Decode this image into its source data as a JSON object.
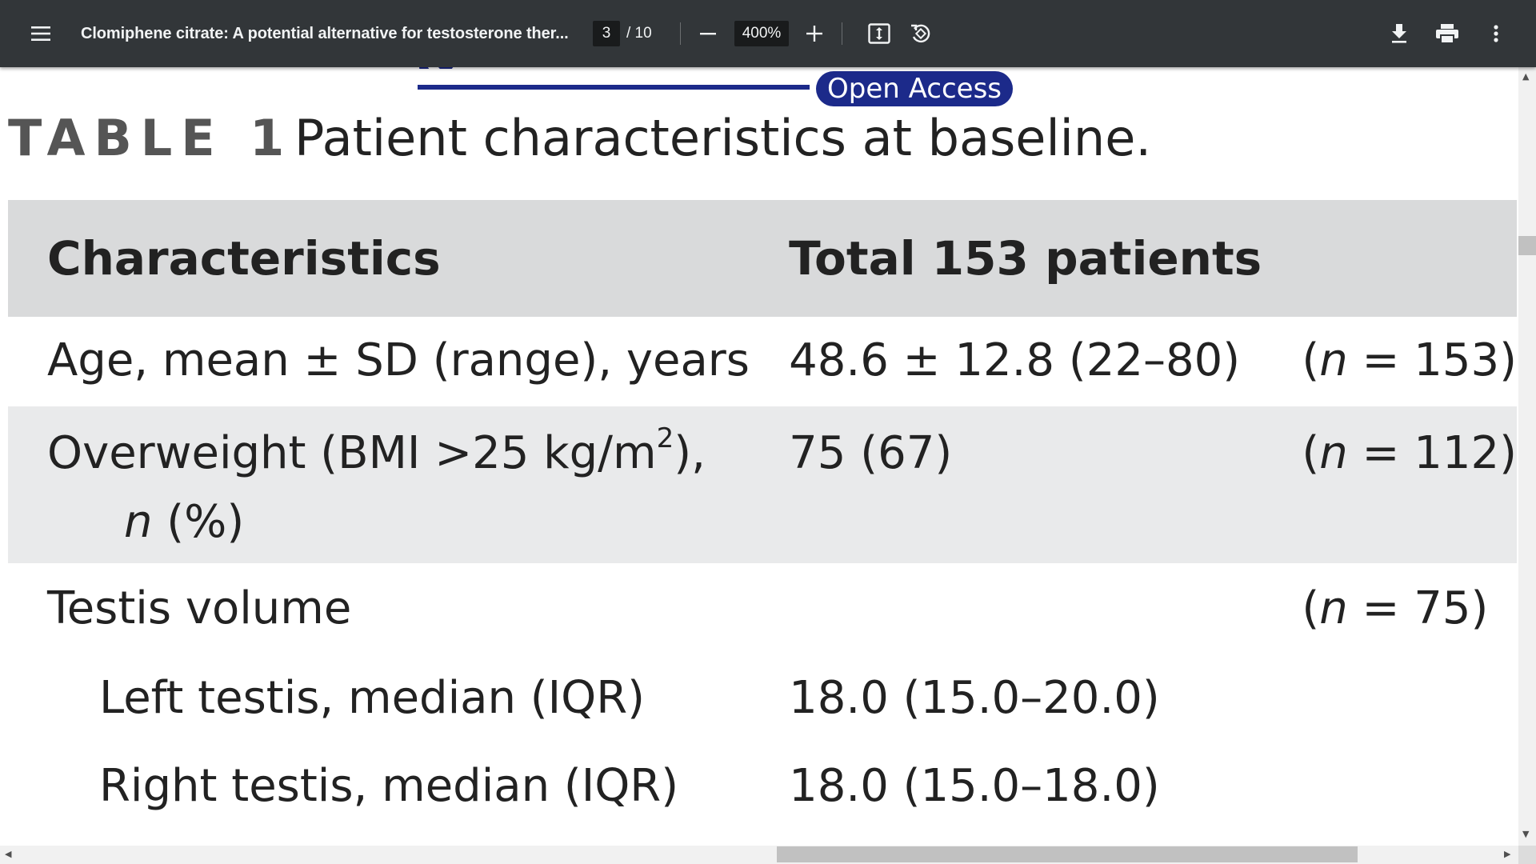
{
  "toolbar": {
    "menu_icon": "hamburger-menu-icon",
    "title": "Clomiphene citrate: A potential alternative for testosterone ther...",
    "current_page": "3",
    "page_total": "/ 10",
    "zoom": "400%",
    "zoom_out_icon": "minus-icon",
    "zoom_in_icon": "plus-icon",
    "fit_icon": "fit-to-page-icon",
    "rotate_icon": "rotate-counterclockwise-icon",
    "download_icon": "download-icon",
    "print_icon": "print-icon",
    "more_icon": "more-vertical-icon"
  },
  "document": {
    "open_access_badge": "Open Access",
    "table_label": "TABLE 1",
    "table_caption": "Patient characteristics at baseline.",
    "header": {
      "col1": "Characteristics",
      "col2": "Total 153 patients"
    },
    "rows": [
      {
        "label": "Age, mean ± SD (range), years",
        "value": "48.6 ± 12.8 (22–80)",
        "n_open": "(",
        "n_var": "n",
        "n_rest": " = 153)"
      },
      {
        "label_part1": "Overweight (BMI >25 kg/m",
        "label_sup": "2",
        "label_part2": "),",
        "label_line2_var": "n",
        "label_line2_rest": " (%)",
        "value": "75 (67)",
        "n_open": "(",
        "n_var": "n",
        "n_rest": " = 112)"
      },
      {
        "label": "Testis volume",
        "value": "",
        "n_open": "(",
        "n_var": "n",
        "n_rest": " = 75)"
      },
      {
        "label": "Left testis, median (IQR)",
        "value": "18.0 (15.0–20.0)"
      },
      {
        "label": "Right testis, median (IQR)",
        "value": "18.0 (15.0–18.0)"
      }
    ]
  },
  "colors": {
    "toolbar_bg": "#323639",
    "journal_blue": "#1c2a8a",
    "header_row_bg": "#d9dadb",
    "shaded_row_bg": "#e9eaeb"
  }
}
